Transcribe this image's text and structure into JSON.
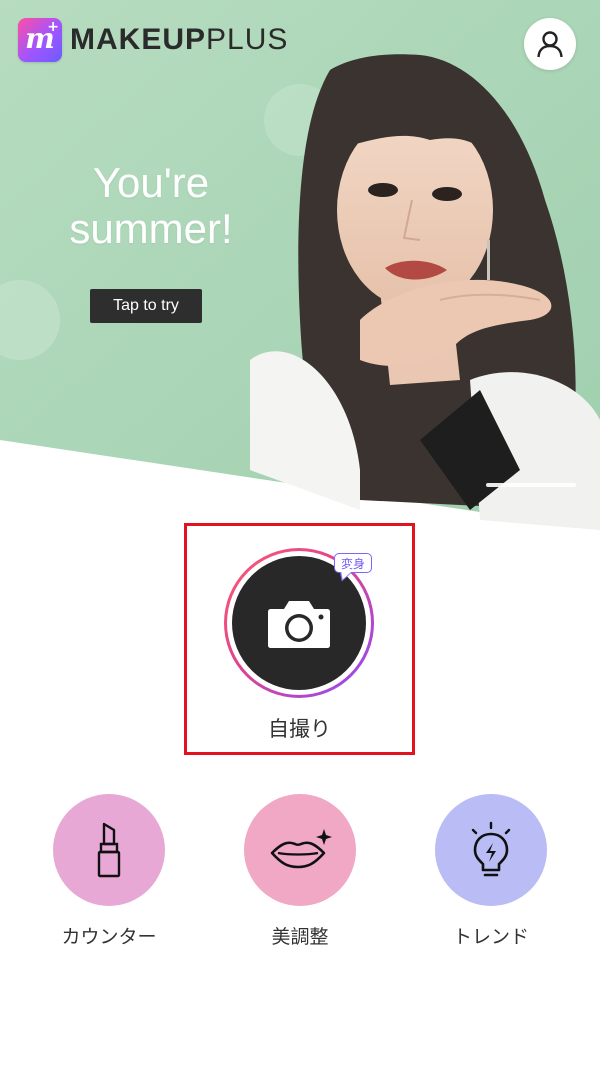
{
  "app": {
    "brand_bold": "MAKEUP",
    "brand_light": "PLUS",
    "logo_letter": "m",
    "logo_plus": "+"
  },
  "header": {
    "profile_icon": "user-icon"
  },
  "banner": {
    "headline_line1": "You're",
    "headline_line2": "summer!",
    "cta_label": "Tap to try",
    "colors": {
      "background": "#a9d3b4",
      "cta_background": "#2e2e2e"
    }
  },
  "camera": {
    "badge": "変身",
    "label": "自撮り",
    "icon": "camera-icon",
    "colors": {
      "button": "#282828",
      "ring_start": "#ff5a6e",
      "ring_end": "#8c4bff",
      "highlight": "#e2131f"
    }
  },
  "features": [
    {
      "label": "カウンター",
      "icon": "lipstick-icon",
      "color": "#e8a8d6"
    },
    {
      "label": "美調整",
      "icon": "lips-icon",
      "color": "#f0a8c4"
    },
    {
      "label": "トレンド",
      "icon": "lightbulb-icon",
      "color": "#b9bcf5"
    }
  ]
}
